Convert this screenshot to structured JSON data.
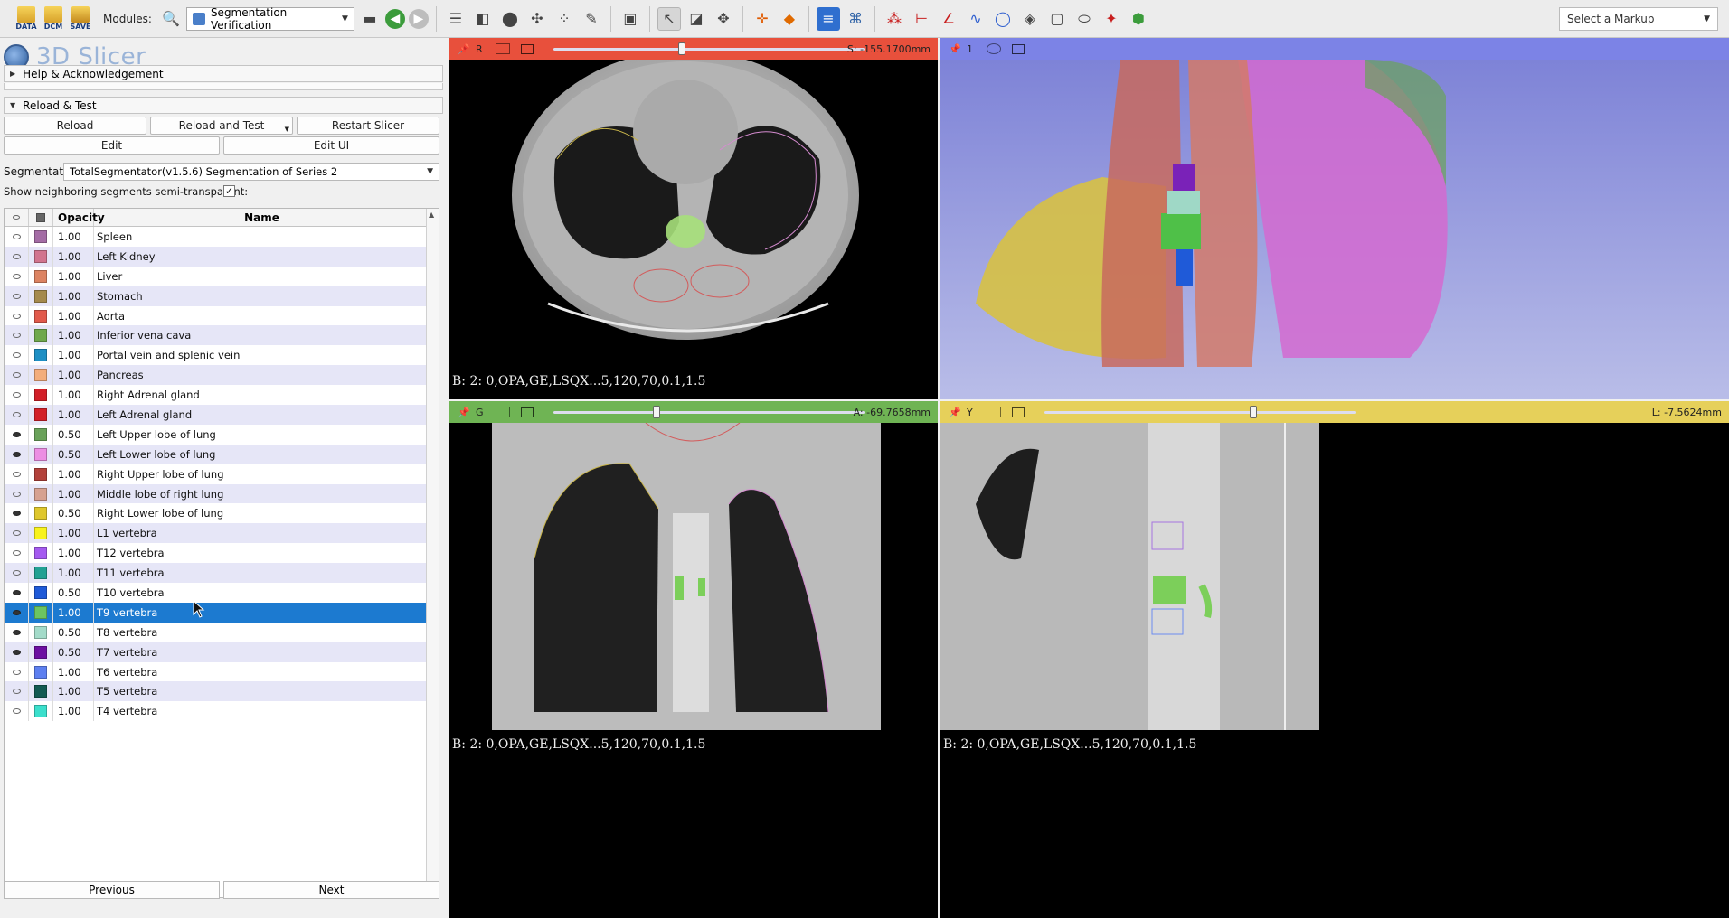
{
  "toolbar": {
    "data_label": "DATA",
    "dcm_label": "DCM",
    "save_label": "SAVE",
    "modules_label": "Modules:",
    "module_selected": "Segmentation Verification",
    "markup_select": "Select a Markup"
  },
  "app": {
    "title": "3D Slicer"
  },
  "sections": {
    "help": "Help & Acknowledgement",
    "reload": "Reload & Test"
  },
  "buttons": {
    "reload": "Reload",
    "reload_test": "Reload and Test",
    "restart": "Restart Slicer",
    "edit": "Edit",
    "edit_ui": "Edit UI",
    "previous": "Previous",
    "next": "Next"
  },
  "segmentation": {
    "label": "Segmentation:",
    "value": "TotalSegmentator(v1.5.6) Segmentation of Series 2",
    "neighbor_label": "Show neighboring segments semi-transparent:",
    "neighbor_checked": "✓"
  },
  "table": {
    "headers": {
      "opacity": "Opacity",
      "name": "Name"
    },
    "rows": [
      {
        "visible": false,
        "color": "#a46ca5",
        "opacity": "1.00",
        "name": "Spleen"
      },
      {
        "visible": false,
        "color": "#d1748e",
        "opacity": "1.00",
        "name": "Left Kidney"
      },
      {
        "visible": false,
        "color": "#dc8362",
        "opacity": "1.00",
        "name": "Liver"
      },
      {
        "visible": false,
        "color": "#a58a4d",
        "opacity": "1.00",
        "name": "Stomach"
      },
      {
        "visible": false,
        "color": "#e15a4c",
        "opacity": "1.00",
        "name": "Aorta"
      },
      {
        "visible": false,
        "color": "#6fa84c",
        "opacity": "1.00",
        "name": "Inferior vena cava"
      },
      {
        "visible": false,
        "color": "#1e8fc4",
        "opacity": "1.00",
        "name": "Portal vein and splenic vein"
      },
      {
        "visible": false,
        "color": "#f3ad7c",
        "opacity": "1.00",
        "name": "Pancreas"
      },
      {
        "visible": false,
        "color": "#d21f28",
        "opacity": "1.00",
        "name": "Right Adrenal gland"
      },
      {
        "visible": false,
        "color": "#d21f28",
        "opacity": "1.00",
        "name": "Left Adrenal gland"
      },
      {
        "visible": true,
        "color": "#6aa25a",
        "opacity": "0.50",
        "name": "Left Upper lobe of lung"
      },
      {
        "visible": true,
        "color": "#ec8ee3",
        "opacity": "0.50",
        "name": "Left Lower lobe of lung"
      },
      {
        "visible": false,
        "color": "#b3423b",
        "opacity": "1.00",
        "name": "Right Upper lobe of lung"
      },
      {
        "visible": false,
        "color": "#d6a191",
        "opacity": "1.00",
        "name": "Middle lobe of right lung"
      },
      {
        "visible": true,
        "color": "#dfc72c",
        "opacity": "0.50",
        "name": "Right Lower lobe of lung"
      },
      {
        "visible": false,
        "color": "#f8f21c",
        "opacity": "1.00",
        "name": "L1 vertebra"
      },
      {
        "visible": false,
        "color": "#a45af0",
        "opacity": "1.00",
        "name": "T12 vertebra"
      },
      {
        "visible": false,
        "color": "#22a193",
        "opacity": "1.00",
        "name": "T11 vertebra"
      },
      {
        "visible": true,
        "color": "#1f5ad8",
        "opacity": "0.50",
        "name": "T10 vertebra"
      },
      {
        "visible": true,
        "color": "#6cc560",
        "opacity": "1.00",
        "name": "T9 vertebra",
        "selected": true
      },
      {
        "visible": true,
        "color": "#a3dbc9",
        "opacity": "0.50",
        "name": "T8 vertebra"
      },
      {
        "visible": true,
        "color": "#6c0fa1",
        "opacity": "0.50",
        "name": "T7 vertebra"
      },
      {
        "visible": false,
        "color": "#5d7ff0",
        "opacity": "1.00",
        "name": "T6 vertebra"
      },
      {
        "visible": false,
        "color": "#125a52",
        "opacity": "1.00",
        "name": "T5 vertebra"
      },
      {
        "visible": false,
        "color": "#3bdfcc",
        "opacity": "1.00",
        "name": "T4 vertebra"
      }
    ]
  },
  "views": {
    "red": {
      "label": "R",
      "readout": "S: -155.1700mm",
      "corner": "B: 2: 0,OPA,GE,LSQX...5,120,70,0.1,1.5",
      "slider_frac": 0.4,
      "bar_color": "#e8503c"
    },
    "threed": {
      "label": "1",
      "bar_color": "#7c83e6"
    },
    "green": {
      "label": "G",
      "readout": "A: -69.7658mm",
      "corner": "B: 2: 0,OPA,GE,LSQX...5,120,70,0.1,1.5",
      "slider_frac": 0.32,
      "bar_color": "#6fb454"
    },
    "yellow": {
      "label": "Y",
      "readout": "L: -7.5624mm",
      "corner": "B: 2: 0,OPA,GE,LSQX...5,120,70,0.1,1.5",
      "slider_frac": 0.66,
      "bar_color": "#e6d05a"
    }
  }
}
